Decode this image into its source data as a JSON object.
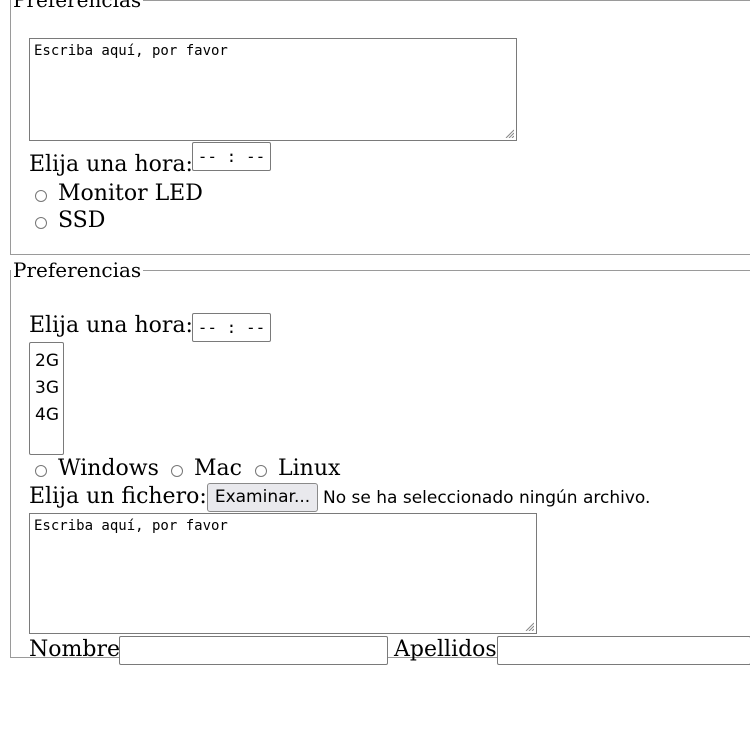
{
  "fieldset1": {
    "legend": "Preferencias",
    "textarea": {
      "value": "Escriba aquí, por favor"
    },
    "time_label": "Elija una hora:",
    "time_value": "-- : --",
    "radio_options": [
      {
        "label": "Monitor LED",
        "checked": false
      },
      {
        "label": "SSD",
        "checked": false
      }
    ]
  },
  "fieldset2": {
    "legend": "Preferencias",
    "time_label": "Elija una hora:",
    "time_value": "-- : --",
    "listbox_options": [
      "2G",
      "3G",
      "4G"
    ],
    "radio_options": [
      {
        "label": "Windows",
        "checked": false
      },
      {
        "label": "Mac",
        "checked": false
      },
      {
        "label": "Linux",
        "checked": false
      }
    ],
    "file": {
      "label": "Elija un fichero:",
      "button_label": "Examinar...",
      "status": "No se ha seleccionado ningún archivo."
    },
    "textarea": {
      "value": "Escriba aquí, por favor"
    },
    "nombre_label": "Nombre",
    "nombre_value": "",
    "apellidos_label": "Apellidos",
    "apellidos_value": ""
  },
  "icons": {
    "resize_grip": "resize-grip-icon",
    "radio": "radio-button"
  },
  "colors": {
    "border": "#9a9a9a",
    "input_border": "#7a7a7a",
    "button_background": "#e9e9ed"
  }
}
